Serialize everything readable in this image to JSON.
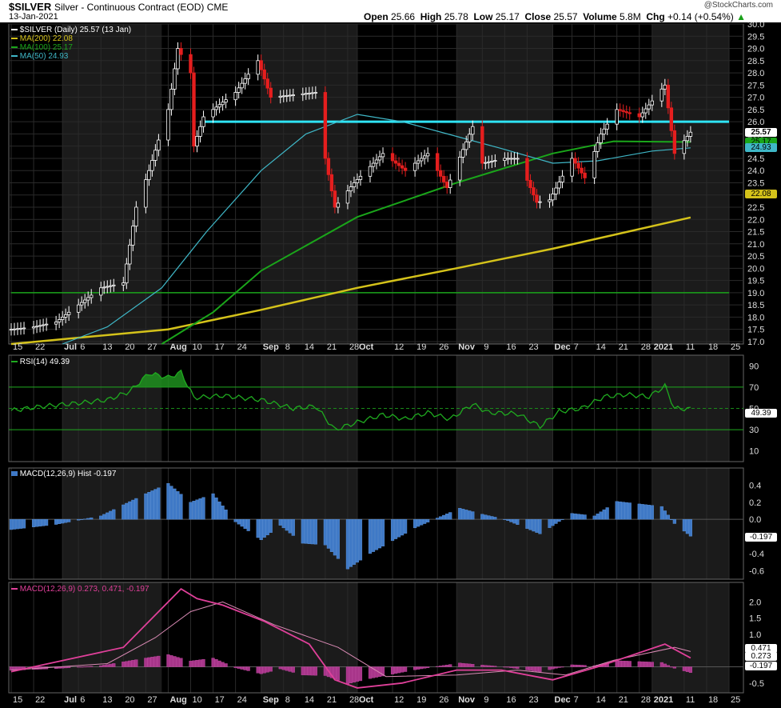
{
  "header": {
    "symbol": "$SILVER",
    "name": "Silver - Continuous Contract (EOD)",
    "exchange": "CME",
    "date": "13-Jan-2021",
    "brand": "@StockCharts.com",
    "open_label": "Open",
    "open": "25.66",
    "high_label": "High",
    "high": "25.78",
    "low_label": "Low",
    "low": "25.17",
    "close_label": "Close",
    "close": "25.57",
    "volume_label": "Volume",
    "volume": "5.8M",
    "chg_label": "Chg",
    "chg": "+0.14 (+0.54%)"
  },
  "colors": {
    "background": "#000000",
    "grid": "#2a2a2a",
    "up_candle": "#ffffff",
    "down_candle": "#e51e1e",
    "ma200": "#d4c21a",
    "ma100": "#1aa51a",
    "ma50": "#3fb7c7",
    "resistance": "#2fe4f4",
    "rsi": "#1faa1f",
    "macd_hist": "#3f79c6",
    "macd_line": "#e0409a"
  },
  "price_legend": {
    "series": "$SILVER (Daily) 25.57 (13 Jan)",
    "ma200": "MA(200) 22.08",
    "ma100": "MA(100) 25.17",
    "ma50": "MA(50) 24.93"
  },
  "price_badges": {
    "close": "25.57",
    "ma100": "25.17",
    "ma50": "24.93",
    "ma200": "22.08"
  },
  "rsi_legend": "RSI(14) 49.39",
  "rsi_badge": "49.39",
  "hist_legend": "MACD(12,26,9) Hist -0.197",
  "hist_badge": "-0.197",
  "macd_legend": "MACD(12,26,9) 0.273, 0.471, -0.197",
  "macd_badges": {
    "signal": "0.471",
    "macd": "0.273",
    "hist": "-0.197"
  },
  "x_tick_labels": [
    "15",
    "22",
    "Jul",
    "6",
    "13",
    "20",
    "27",
    "Aug",
    "10",
    "17",
    "24",
    "Sep",
    "8",
    "14",
    "21",
    "28",
    "Oct",
    "12",
    "19",
    "26",
    "Nov",
    "9",
    "16",
    "23",
    "Dec",
    "7",
    "14",
    "21",
    "28",
    "2021",
    "11",
    "18",
    "25"
  ],
  "chart_data": [
    {
      "type": "candlestick",
      "title": "$SILVER Silver - Continuous Contract (EOD)",
      "x_range": [
        "2020-06-15",
        "2021-01-25"
      ],
      "ylim": [
        16.9,
        30.0
      ],
      "y_ticks": [
        "17.0",
        "17.5",
        "18.0",
        "18.5",
        "19.0",
        "19.5",
        "20.0",
        "20.5",
        "21.0",
        "21.5",
        "22.0",
        "22.5",
        "23.0",
        "23.5",
        "24.0",
        "24.5",
        "25.0",
        "25.5",
        "26.0",
        "26.5",
        "27.0",
        "27.5",
        "28.0",
        "28.5",
        "29.0",
        "29.5",
        "30.0"
      ],
      "horizontal_lines": [
        {
          "y": 26.0,
          "from": "2020-08-14",
          "to": "2021-01-25",
          "color": "#2fe4f4"
        },
        {
          "y": 19.0,
          "from": "2020-06-15",
          "to": "2021-01-25",
          "color": "#1aa51a"
        }
      ],
      "close_path": [
        [
          "2020-06-15",
          17.5
        ],
        [
          "2020-06-22",
          17.6
        ],
        [
          "2020-06-29",
          17.8
        ],
        [
          "2020-07-06",
          18.5
        ],
        [
          "2020-07-13",
          19.2
        ],
        [
          "2020-07-20",
          19.4
        ],
        [
          "2020-07-24",
          22.5
        ],
        [
          "2020-07-28",
          24.0
        ],
        [
          "2020-08-03",
          26.5
        ],
        [
          "2020-08-06",
          29.0
        ],
        [
          "2020-08-10",
          28.0
        ],
        [
          "2020-08-11",
          25.0
        ],
        [
          "2020-08-14",
          26.2
        ],
        [
          "2020-08-24",
          27.2
        ],
        [
          "2020-08-31",
          28.5
        ],
        [
          "2020-09-04",
          27.0
        ],
        [
          "2020-09-11",
          27.1
        ],
        [
          "2020-09-18",
          27.2
        ],
        [
          "2020-09-21",
          24.5
        ],
        [
          "2020-09-24",
          22.5
        ],
        [
          "2020-09-30",
          23.5
        ],
        [
          "2020-10-09",
          24.7
        ],
        [
          "2020-10-16",
          24.0
        ],
        [
          "2020-10-23",
          24.7
        ],
        [
          "2020-10-29",
          23.3
        ],
        [
          "2020-11-06",
          25.8
        ],
        [
          "2020-11-09",
          24.3
        ],
        [
          "2020-11-16",
          24.5
        ],
        [
          "2020-11-20",
          24.5
        ],
        [
          "2020-11-26",
          22.7
        ],
        [
          "2020-11-30",
          22.8
        ],
        [
          "2020-12-07",
          24.5
        ],
        [
          "2020-12-11",
          23.7
        ],
        [
          "2020-12-16",
          25.5
        ],
        [
          "2020-12-21",
          26.5
        ],
        [
          "2020-12-28",
          26.2
        ],
        [
          "2021-01-05",
          27.5
        ],
        [
          "2021-01-08",
          24.7
        ],
        [
          "2021-01-12",
          25.4
        ],
        [
          "2021-01-13",
          25.57
        ]
      ],
      "series": [
        {
          "name": "MA(200)",
          "last": 22.08,
          "points": [
            [
              "2020-06-15",
              16.9
            ],
            [
              "2020-08-03",
              17.5
            ],
            [
              "2020-09-01",
              18.3
            ],
            [
              "2020-10-01",
              19.2
            ],
            [
              "2020-11-01",
              20.0
            ],
            [
              "2020-12-01",
              20.8
            ],
            [
              "2021-01-13",
              22.08
            ]
          ]
        },
        {
          "name": "MA(100)",
          "last": 25.17,
          "points": [
            [
              "2020-08-01",
              16.9
            ],
            [
              "2020-08-17",
              18.2
            ],
            [
              "2020-09-01",
              19.9
            ],
            [
              "2020-10-01",
              22.1
            ],
            [
              "2020-11-01",
              23.5
            ],
            [
              "2020-12-01",
              24.7
            ],
            [
              "2020-12-20",
              25.2
            ],
            [
              "2021-01-13",
              25.17
            ]
          ]
        },
        {
          "name": "MA(50)",
          "last": 24.93,
          "points": [
            [
              "2020-07-01",
              16.9
            ],
            [
              "2020-07-15",
              17.6
            ],
            [
              "2020-08-01",
              19.2
            ],
            [
              "2020-08-15",
              21.5
            ],
            [
              "2020-09-01",
              24.0
            ],
            [
              "2020-09-15",
              25.5
            ],
            [
              "2020-10-01",
              26.3
            ],
            [
              "2020-10-15",
              26.0
            ],
            [
              "2020-11-01",
              25.4
            ],
            [
              "2020-11-15",
              24.9
            ],
            [
              "2020-12-01",
              24.3
            ],
            [
              "2020-12-15",
              24.4
            ],
            [
              "2021-01-01",
              24.8
            ],
            [
              "2021-01-13",
              24.93
            ]
          ]
        }
      ]
    },
    {
      "type": "line",
      "title": "RSI(14)",
      "last": 49.39,
      "ylim": [
        0,
        100
      ],
      "y_ticks": [
        10,
        30,
        50,
        70,
        90
      ],
      "reference_lines": [
        30,
        50,
        70
      ],
      "points": [
        [
          "2020-06-15",
          48
        ],
        [
          "2020-06-25",
          52
        ],
        [
          "2020-07-06",
          55
        ],
        [
          "2020-07-15",
          58
        ],
        [
          "2020-07-22",
          66
        ],
        [
          "2020-07-28",
          83
        ],
        [
          "2020-08-03",
          79
        ],
        [
          "2020-08-07",
          84
        ],
        [
          "2020-08-11",
          60
        ],
        [
          "2020-08-20",
          62
        ],
        [
          "2020-09-01",
          58
        ],
        [
          "2020-09-11",
          50
        ],
        [
          "2020-09-18",
          52
        ],
        [
          "2020-09-24",
          30
        ],
        [
          "2020-10-01",
          37
        ],
        [
          "2020-10-09",
          44
        ],
        [
          "2020-10-16",
          40
        ],
        [
          "2020-10-23",
          46
        ],
        [
          "2020-10-30",
          40
        ],
        [
          "2020-11-06",
          54
        ],
        [
          "2020-11-11",
          46
        ],
        [
          "2020-11-20",
          45
        ],
        [
          "2020-11-27",
          33
        ],
        [
          "2020-12-03",
          47
        ],
        [
          "2020-12-10",
          50
        ],
        [
          "2020-12-17",
          61
        ],
        [
          "2020-12-24",
          63
        ],
        [
          "2020-12-31",
          61
        ],
        [
          "2021-01-05",
          71
        ],
        [
          "2021-01-08",
          50
        ],
        [
          "2021-01-13",
          49.39
        ]
      ]
    },
    {
      "type": "bar",
      "title": "MACD(12,26,9) Hist",
      "last": -0.197,
      "ylim": [
        -0.7,
        0.6
      ],
      "y_ticks": [
        -0.6,
        -0.4,
        -0.2,
        0.0,
        0.2,
        0.4
      ],
      "points": [
        [
          "2020-06-15",
          -0.12
        ],
        [
          "2020-06-29",
          -0.06
        ],
        [
          "2020-07-13",
          0.04
        ],
        [
          "2020-07-27",
          0.3
        ],
        [
          "2020-08-03",
          0.42
        ],
        [
          "2020-08-10",
          0.2
        ],
        [
          "2020-08-17",
          0.3
        ],
        [
          "2020-08-24",
          -0.03
        ],
        [
          "2020-09-01",
          -0.24
        ],
        [
          "2020-09-07",
          -0.07
        ],
        [
          "2020-09-14",
          -0.28
        ],
        [
          "2020-09-21",
          -0.3
        ],
        [
          "2020-09-28",
          -0.58
        ],
        [
          "2020-10-05",
          -0.4
        ],
        [
          "2020-10-19",
          -0.1
        ],
        [
          "2020-11-02",
          0.13
        ],
        [
          "2020-11-09",
          0.06
        ],
        [
          "2020-11-16",
          0.0
        ],
        [
          "2020-11-27",
          -0.17
        ],
        [
          "2020-12-07",
          0.07
        ],
        [
          "2020-12-14",
          0.04
        ],
        [
          "2020-12-21",
          0.21
        ],
        [
          "2021-01-04",
          0.15
        ],
        [
          "2021-01-08",
          -0.05
        ],
        [
          "2021-01-13",
          -0.197
        ]
      ]
    },
    {
      "type": "line",
      "title": "MACD(12,26,9)",
      "ylim": [
        -0.8,
        2.6
      ],
      "y_ticks": [
        -0.5,
        0.0,
        0.5,
        1.0,
        1.5,
        2.0
      ],
      "series": [
        {
          "name": "MACD",
          "last": 0.273,
          "points": [
            [
              "2020-06-15",
              -0.15
            ],
            [
              "2020-07-06",
              0.3
            ],
            [
              "2020-07-20",
              0.6
            ],
            [
              "2020-07-30",
              1.6
            ],
            [
              "2020-08-07",
              2.4
            ],
            [
              "2020-08-12",
              2.1
            ],
            [
              "2020-08-20",
              1.9
            ],
            [
              "2020-09-02",
              1.4
            ],
            [
              "2020-09-16",
              0.7
            ],
            [
              "2020-09-24",
              -0.4
            ],
            [
              "2020-10-01",
              -0.65
            ],
            [
              "2020-10-15",
              -0.5
            ],
            [
              "2020-11-01",
              -0.1
            ],
            [
              "2020-11-15",
              -0.1
            ],
            [
              "2020-12-01",
              -0.4
            ],
            [
              "2020-12-15",
              0.0
            ],
            [
              "2021-01-05",
              0.7
            ],
            [
              "2021-01-13",
              0.273
            ]
          ]
        },
        {
          "name": "Signal",
          "last": 0.471,
          "points": [
            [
              "2020-06-15",
              -0.1
            ],
            [
              "2020-07-15",
              0.1
            ],
            [
              "2020-07-30",
              0.9
            ],
            [
              "2020-08-10",
              1.7
            ],
            [
              "2020-08-20",
              2.0
            ],
            [
              "2020-09-05",
              1.3
            ],
            [
              "2020-09-25",
              0.6
            ],
            [
              "2020-10-10",
              -0.3
            ],
            [
              "2020-11-01",
              -0.25
            ],
            [
              "2020-11-20",
              -0.1
            ],
            [
              "2020-12-05",
              -0.25
            ],
            [
              "2020-12-20",
              0.2
            ],
            [
              "2021-01-08",
              0.6
            ],
            [
              "2021-01-13",
              0.471
            ]
          ]
        }
      ]
    }
  ]
}
